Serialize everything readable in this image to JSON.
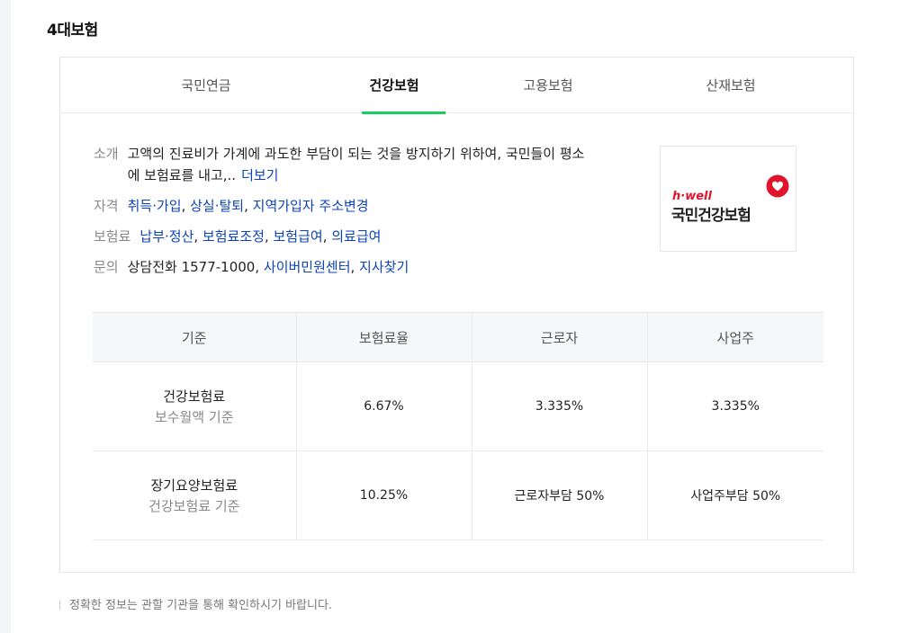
{
  "section": {
    "title": "4대보험"
  },
  "tabs": [
    {
      "label": "국민연금"
    },
    {
      "label": "건강보험"
    },
    {
      "label": "고용보험"
    },
    {
      "label": "산재보험"
    }
  ],
  "info": {
    "intro": {
      "label": "소개",
      "text": "고액의 진료비가 가계에 과도한 부담이 되는 것을 방지하기 위하여, 국민들이 평소에 보험료를 내고,..",
      "more": "더보기"
    },
    "qualification": {
      "label": "자격",
      "links": [
        "취득·가입",
        "상실·탈퇴",
        "지역가입자 주소변경"
      ]
    },
    "premium": {
      "label": "보험료",
      "links": [
        "납부·정산",
        "보험료조정",
        "보험급여",
        "의료급여"
      ]
    },
    "inquiry": {
      "label": "문의",
      "phone": "상담전화 1577-1000,",
      "links": [
        "사이버민원센터",
        "지사찾기"
      ]
    }
  },
  "logo": {
    "tagline": "h·well",
    "name": "국민건강보험"
  },
  "table": {
    "headers": [
      "기준",
      "보험료율",
      "근로자",
      "사업주"
    ],
    "rows": [
      {
        "name": "건강보험료",
        "basis": "보수월액 기준",
        "rate": "6.67%",
        "worker": "3.335%",
        "employer": "3.335%"
      },
      {
        "name": "장기요양보험료",
        "basis": "건강보험료 기준",
        "rate": "10.25%",
        "worker": "근로자부담 50%",
        "employer": "사업주부담 50%"
      }
    ]
  },
  "footer": {
    "note": "정확한 정보는 관할 기관을 통해 확인하시기 바랍니다."
  },
  "colors": {
    "accent": "#19ce60",
    "link": "#0c43b7",
    "logo_red": "#e0142b"
  }
}
